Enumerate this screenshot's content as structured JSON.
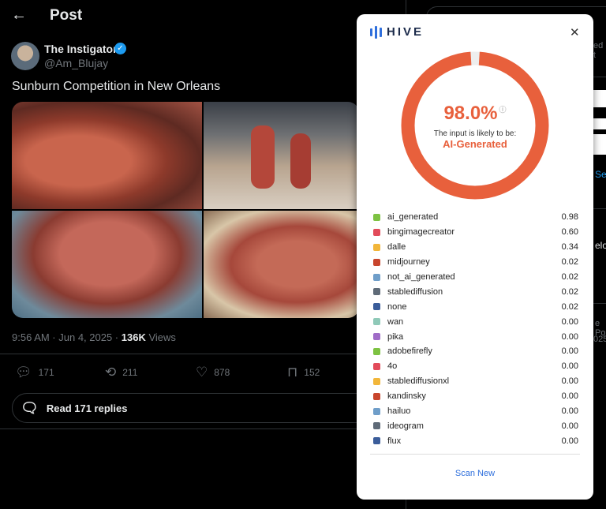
{
  "header": {
    "title": "Post"
  },
  "author": {
    "name": "The Instigator",
    "handle": "@Am_Blujay"
  },
  "tweet": {
    "text": "Sunburn Competition in New Orleans",
    "time": "9:56 AM · Jun 4, 2025 · ",
    "views_count": "136K",
    "views_label": " Views"
  },
  "actions": {
    "replies": "171",
    "reposts": "211",
    "likes": "878",
    "bookmarks": "152"
  },
  "read_replies": "Read 171 replies",
  "right_column": {
    "snippet_1": "ed t",
    "snippet_2": "Se",
    "snippet_3": "elo",
    "snippet_4": "e Po",
    "snippet_5": "025"
  },
  "hive": {
    "brand": "HIVE",
    "score": "98.0%",
    "score_fraction": 0.98,
    "likely_label": "The input is likely to be:",
    "verdict": "AI-Generated",
    "accent": "#e8603c",
    "items": [
      {
        "label": "ai_generated",
        "value": "0.98",
        "color": "#7dc242"
      },
      {
        "label": "bingimagecreator",
        "value": "0.60",
        "color": "#e24b5a"
      },
      {
        "label": "dalle",
        "value": "0.34",
        "color": "#f2b63a"
      },
      {
        "label": "midjourney",
        "value": "0.02",
        "color": "#c8452d"
      },
      {
        "label": "not_ai_generated",
        "value": "0.02",
        "color": "#6f9ec9"
      },
      {
        "label": "stablediffusion",
        "value": "0.02",
        "color": "#5f6b78"
      },
      {
        "label": "none",
        "value": "0.02",
        "color": "#3b5d9a"
      },
      {
        "label": "wan",
        "value": "0.00",
        "color": "#8fc9b8"
      },
      {
        "label": "pika",
        "value": "0.00",
        "color": "#a06cc7"
      },
      {
        "label": "adobefirefly",
        "value": "0.00",
        "color": "#7dc242"
      },
      {
        "label": "4o",
        "value": "0.00",
        "color": "#e24b5a"
      },
      {
        "label": "stablediffusionxl",
        "value": "0.00",
        "color": "#f2b63a"
      },
      {
        "label": "kandinsky",
        "value": "0.00",
        "color": "#c8452d"
      },
      {
        "label": "hailuo",
        "value": "0.00",
        "color": "#6f9ec9"
      },
      {
        "label": "ideogram",
        "value": "0.00",
        "color": "#5f6b78"
      },
      {
        "label": "flux",
        "value": "0.00",
        "color": "#3b5d9a"
      }
    ],
    "scan_button": "Scan New"
  }
}
